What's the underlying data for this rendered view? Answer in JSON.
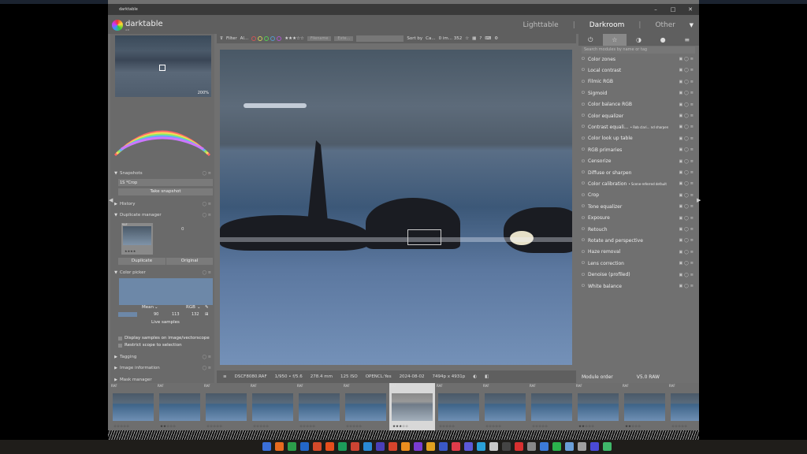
{
  "app": {
    "window_title": "darktable",
    "name": "darktable",
    "version": "4.8"
  },
  "window_controls": {
    "minimize": "–",
    "maximize": "□",
    "close": "✕"
  },
  "views": {
    "lighttable": "Lighttable",
    "darkroom": "Darkroom",
    "other": "Other",
    "separator": "|"
  },
  "navigation": {
    "zoom": "200%"
  },
  "left_panel": {
    "snapshots": {
      "title": "Snapshots",
      "item_index": "1S",
      "item_label": "*Crop",
      "take_button": "Take snapshot"
    },
    "history": {
      "title": "History"
    },
    "duplicate_manager": {
      "title": "Duplicate manager",
      "count": "0",
      "thumb_label": "RAF",
      "stars": "★★★★",
      "duplicate_button": "Duplicate",
      "original_button": "Original"
    },
    "color_picker": {
      "title": "Color picker",
      "mode": "Mean",
      "color_space": "RGB",
      "values": [
        "90",
        "113",
        "132"
      ],
      "live_samples": "Live samples",
      "display_samples": "Display samples on image/vectorscope",
      "restrict_scope": "Restrict scope to selection"
    },
    "tagging": {
      "title": "Tagging"
    },
    "image_information": {
      "title": "Image information"
    },
    "mask_manager": {
      "title": "Mask manager"
    }
  },
  "top_toolbar": {
    "filter_label": "Filter",
    "filter_value": "Al...",
    "rating_stars": "★★★☆☆",
    "filename_placeholder": "Filename",
    "exten_placeholder": "Exte...",
    "sort_label": "Sort by",
    "sort_value": "Ca...",
    "count_text": "0 im... 352",
    "help": "?"
  },
  "image_info_bar": {
    "filename": "DSCF8080.RAF",
    "exposure": "1/950 • f/5.6",
    "focal": "278.4 mm",
    "iso": "125 ISO",
    "opencl": "OPENCL:Yes",
    "date": "2024-08-02",
    "dimensions": "7494p x 4931p"
  },
  "right_panel": {
    "search_placeholder": "Search modules by name or tag",
    "modules": [
      {
        "name": "Color zones",
        "extra": ""
      },
      {
        "name": "Local contrast",
        "extra": ""
      },
      {
        "name": "Filmic RGB",
        "extra": ""
      },
      {
        "name": "Sigmoid",
        "extra": ""
      },
      {
        "name": "Color balance RGB",
        "extra": ""
      },
      {
        "name": "Color equalizer",
        "extra": ""
      },
      {
        "name": "Contrast equali...",
        "extra": "• Rob clari... nd sharpen"
      },
      {
        "name": "Color look up table",
        "extra": ""
      },
      {
        "name": "RGB primaries",
        "extra": ""
      },
      {
        "name": "Censorize",
        "extra": ""
      },
      {
        "name": "Diffuse or sharpen",
        "extra": ""
      },
      {
        "name": "Color calibration",
        "extra": "• Scene-referred default"
      },
      {
        "name": "Crop",
        "extra": ""
      },
      {
        "name": "Tone equalizer",
        "extra": ""
      },
      {
        "name": "Exposure",
        "extra": ""
      },
      {
        "name": "Retouch",
        "extra": ""
      },
      {
        "name": "Rotate and perspective",
        "extra": ""
      },
      {
        "name": "Haze removal",
        "extra": ""
      },
      {
        "name": "Lens correction",
        "extra": ""
      },
      {
        "name": "Denoise (profiled)",
        "extra": ""
      },
      {
        "name": "White balance",
        "extra": ""
      }
    ],
    "module_order_label": "Module order",
    "module_order_value": "V5.0 RAW"
  },
  "filmstrip": {
    "label": "RAF",
    "stars": [
      "☆☆☆☆☆",
      "★★☆☆☆",
      "☆☆☆☆☆",
      "☆☆☆☆☆",
      "☆☆☆☆☆",
      "☆☆☆☆☆",
      "★★★☆☆",
      "☆☆☆☆☆",
      "☆☆☆☆☆",
      "☆☆☆☆☆",
      "★★☆☆☆",
      "★★☆☆☆",
      "☆☆☆☆☆"
    ]
  },
  "colors": {
    "panel": "#707070",
    "header": "#5f5f5f",
    "accent": "#fff"
  }
}
